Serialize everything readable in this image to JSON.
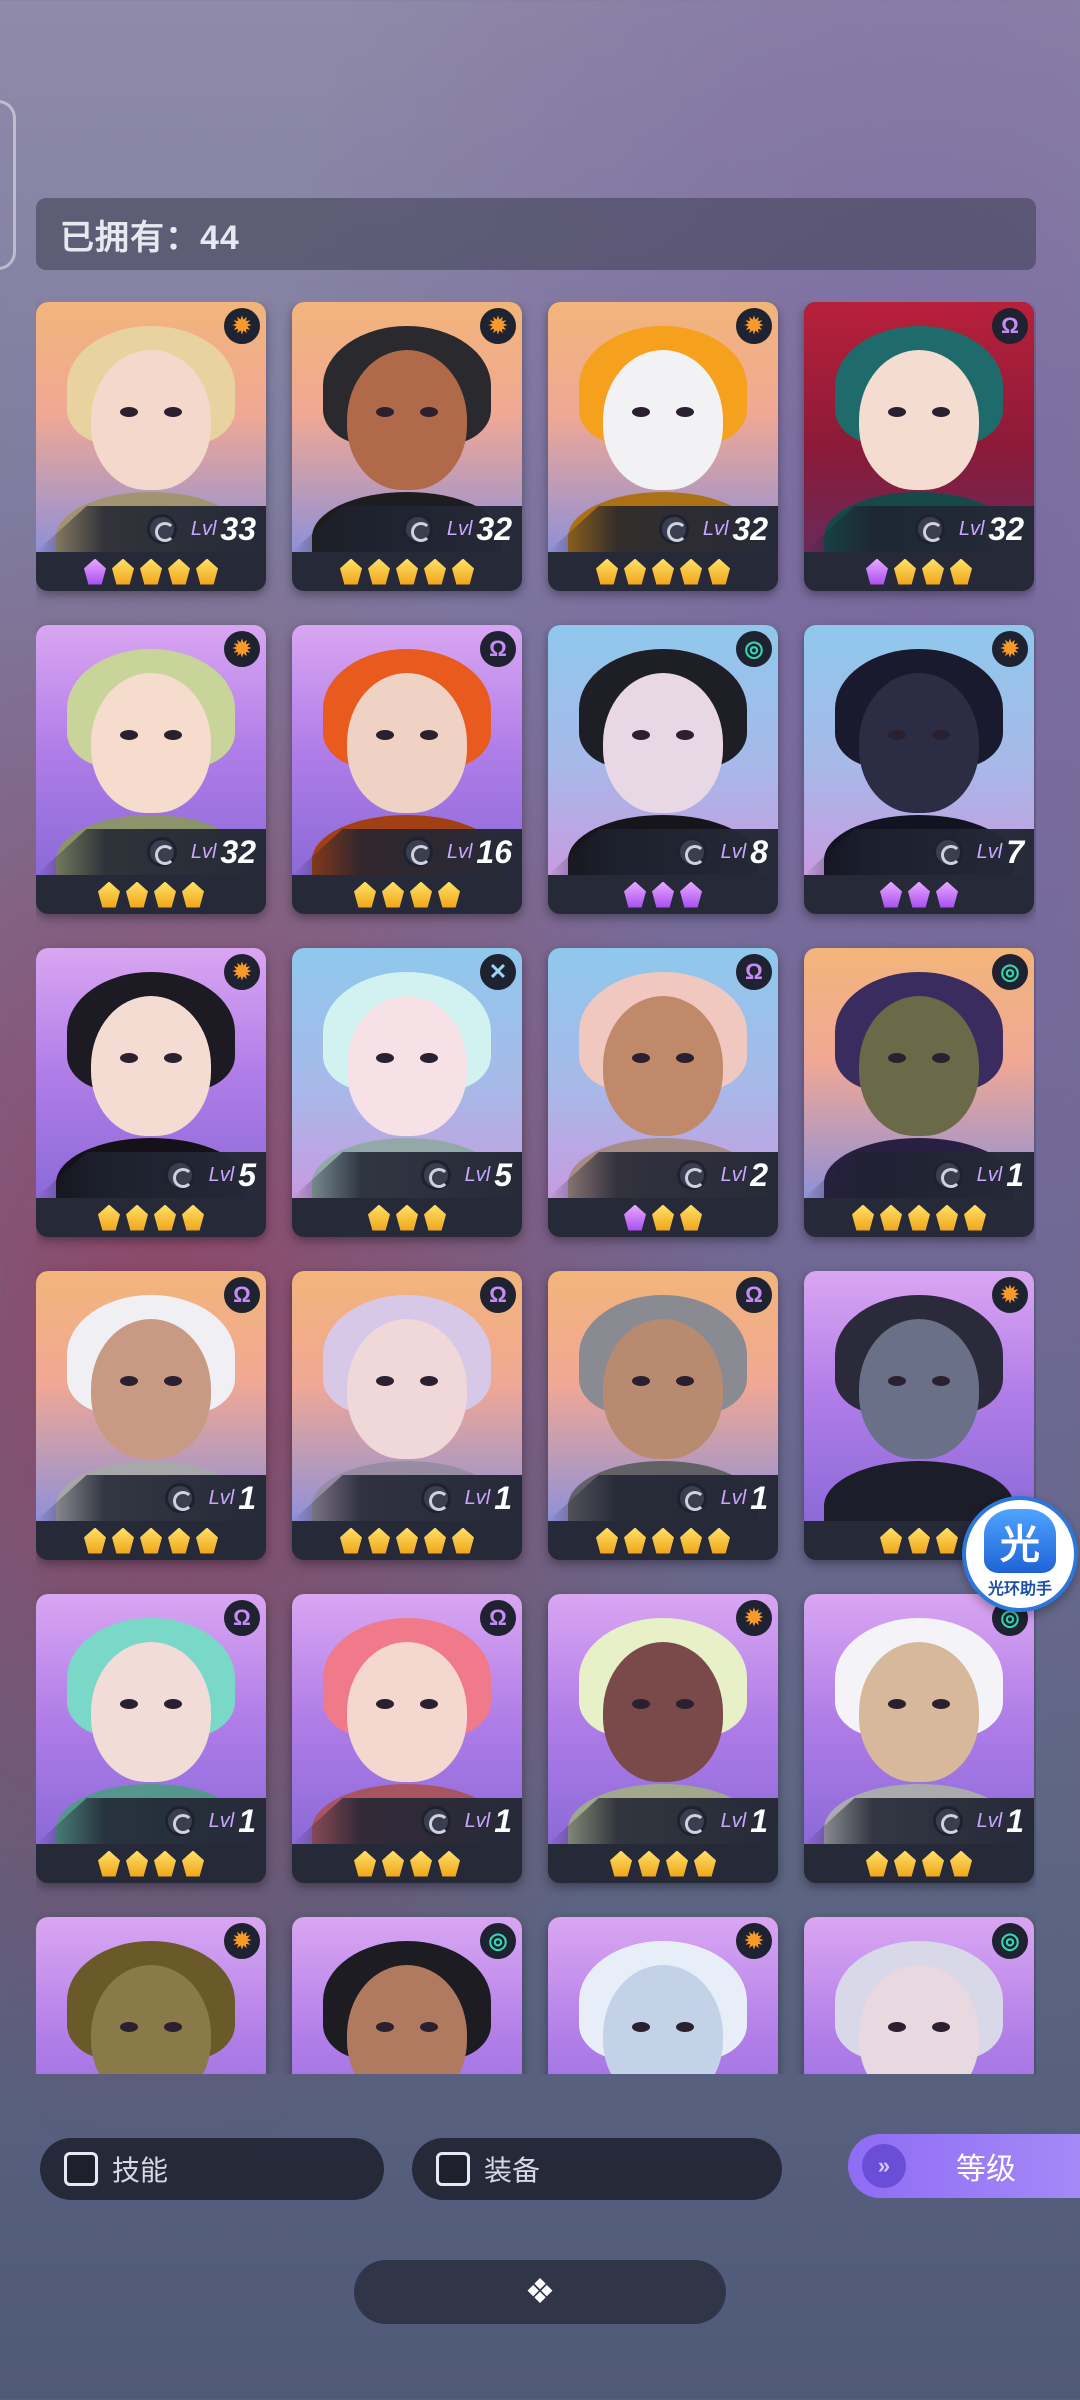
{
  "header": {
    "owned_label": "已拥有：44"
  },
  "level_prefix": "Lvl",
  "cards": [
    {
      "level": "33",
      "cls": "sun",
      "bg": "orange",
      "hair": "#e8d3a0",
      "skin": "#f4d8cc",
      "stars": [
        "purple",
        "gold",
        "gold",
        "gold",
        "gold"
      ]
    },
    {
      "level": "32",
      "cls": "sun",
      "bg": "orange",
      "hair": "#2a2a2e",
      "skin": "#b06a4a",
      "stars": [
        "gold",
        "gold",
        "gold",
        "gold",
        "gold"
      ]
    },
    {
      "level": "32",
      "cls": "sun",
      "bg": "orange",
      "hair": "#f6a11e",
      "skin": "#f2f2f4",
      "stars": [
        "gold",
        "gold",
        "gold",
        "gold",
        "gold"
      ]
    },
    {
      "level": "32",
      "cls": "omega",
      "bg": "red",
      "hair": "#1f6a6a",
      "skin": "#f4dcd0",
      "stars": [
        "purple",
        "gold",
        "gold",
        "gold"
      ]
    },
    {
      "level": "32",
      "cls": "sun",
      "bg": "purple",
      "hair": "#c9d49a",
      "skin": "#f6dccc",
      "stars": [
        "gold",
        "gold",
        "gold",
        "gold"
      ]
    },
    {
      "level": "16",
      "cls": "omega",
      "bg": "purple",
      "hair": "#e85a1e",
      "skin": "#f0d2c4",
      "stars": [
        "gold",
        "gold",
        "gold",
        "gold"
      ]
    },
    {
      "level": "8",
      "cls": "spiral",
      "bg": "blue",
      "hair": "#1e1e26",
      "skin": "#e8d8e6",
      "stars": [
        "purple",
        "purple",
        "purple"
      ]
    },
    {
      "level": "7",
      "cls": "sun",
      "bg": "blue",
      "hair": "#1a1a2e",
      "skin": "#2c2c44",
      "stars": [
        "purple",
        "purple",
        "purple"
      ]
    },
    {
      "level": "5",
      "cls": "sun",
      "bg": "purple",
      "hair": "#1c1a22",
      "skin": "#f4dcd2",
      "stars": [
        "gold",
        "gold",
        "gold",
        "gold"
      ]
    },
    {
      "level": "5",
      "cls": "cross",
      "bg": "blue",
      "hair": "#d2f2f2",
      "skin": "#f6e2e6",
      "stars": [
        "gold",
        "gold",
        "gold"
      ]
    },
    {
      "level": "2",
      "cls": "omega",
      "bg": "blue",
      "hair": "#f0c8c0",
      "skin": "#c08a6a",
      "stars": [
        "purple",
        "gold",
        "gold"
      ]
    },
    {
      "level": "1",
      "cls": "spiral",
      "bg": "orange",
      "hair": "#3a2c5e",
      "skin": "#6a6a48",
      "stars": [
        "gold",
        "gold",
        "gold",
        "gold",
        "gold"
      ]
    },
    {
      "level": "1",
      "cls": "omega",
      "bg": "orange",
      "hair": "#f0f0f4",
      "skin": "#c89a84",
      "stars": [
        "gold",
        "gold",
        "gold",
        "gold",
        "gold"
      ]
    },
    {
      "level": "1",
      "cls": "omega",
      "bg": "orange",
      "hair": "#d8c8e8",
      "skin": "#f0d8d8",
      "stars": [
        "gold",
        "gold",
        "gold",
        "gold",
        "gold"
      ]
    },
    {
      "level": "1",
      "cls": "omega",
      "bg": "orange",
      "hair": "#8a8a92",
      "skin": "#b88a70",
      "stars": [
        "gold",
        "gold",
        "gold",
        "gold",
        "gold"
      ]
    },
    {
      "level": "",
      "cls": "sun",
      "bg": "purple",
      "hair": "#2a2a3a",
      "skin": "#6a7088",
      "stars": [
        "gold",
        "gold",
        "gold"
      ]
    },
    {
      "level": "1",
      "cls": "omega",
      "bg": "purple",
      "hair": "#7ad8c8",
      "skin": "#f2dcd8",
      "stars": [
        "gold",
        "gold",
        "gold",
        "gold"
      ]
    },
    {
      "level": "1",
      "cls": "omega",
      "bg": "purple",
      "hair": "#f07a8a",
      "skin": "#f4d8d0",
      "stars": [
        "gold",
        "gold",
        "gold",
        "gold"
      ]
    },
    {
      "level": "1",
      "cls": "sun",
      "bg": "purple",
      "hair": "#e8f0c8",
      "skin": "#7a4a4a",
      "stars": [
        "gold",
        "gold",
        "gold",
        "gold"
      ]
    },
    {
      "level": "1",
      "cls": "spiral",
      "bg": "purple",
      "hair": "#f4f4f8",
      "skin": "#d8b89a",
      "stars": [
        "gold",
        "gold",
        "gold",
        "gold"
      ]
    },
    {
      "level": "",
      "cls": "sun",
      "bg": "purple",
      "hair": "#6a5a2a",
      "skin": "#8a7a4a",
      "stars": []
    },
    {
      "level": "",
      "cls": "spiral",
      "bg": "purple",
      "hair": "#1c1c22",
      "skin": "#b07a60",
      "stars": []
    },
    {
      "level": "",
      "cls": "sun",
      "bg": "purple",
      "hair": "#e8eef8",
      "skin": "#c4d2e8",
      "stars": []
    },
    {
      "level": "",
      "cls": "spiral",
      "bg": "purple",
      "hair": "#d8d8e8",
      "skin": "#e8d8e0",
      "stars": []
    }
  ],
  "class_glyphs": {
    "sun": "✹",
    "omega": "Ω",
    "spiral": "◎",
    "cross": "✕"
  },
  "filters": {
    "skill": "技能",
    "equip": "装备"
  },
  "sort": {
    "label": "等级",
    "icon": "chevrons-down-icon"
  },
  "badge": {
    "glyph": "光",
    "label": "光环助手"
  },
  "bottom_handle": {
    "icon": "expand-icon"
  }
}
